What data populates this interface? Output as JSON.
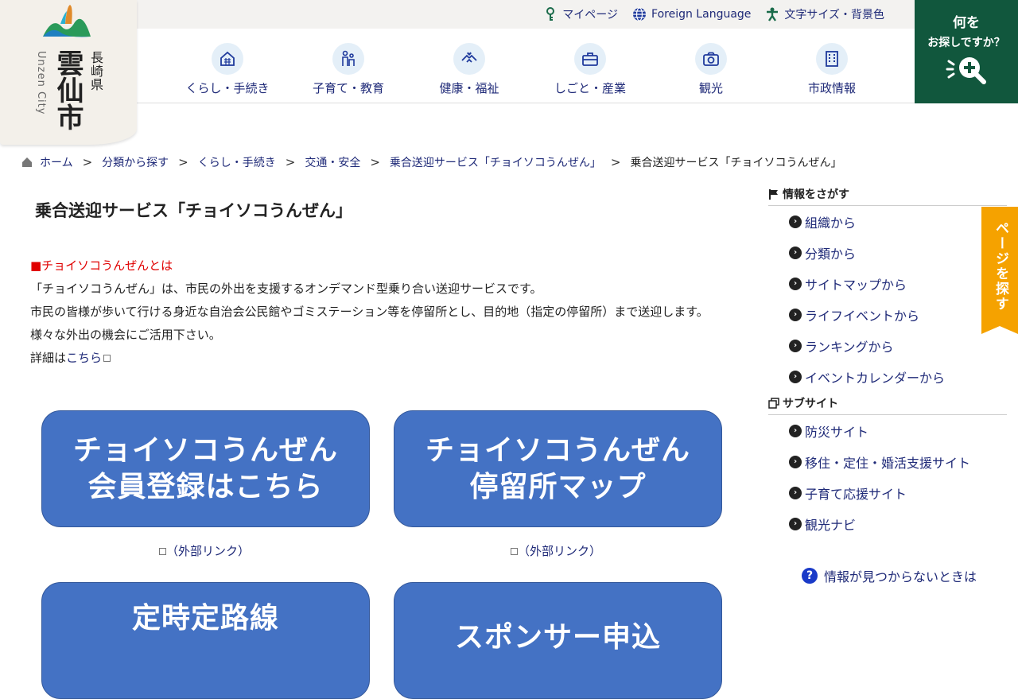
{
  "logo": {
    "city": "雲仙市",
    "prefecture": "長崎県",
    "english": "Unzen City"
  },
  "util": {
    "mypage": "マイページ",
    "foreign": "Foreign Language",
    "fontsize": "文字サイズ・背景色"
  },
  "nav": [
    {
      "label": "くらし・手続き",
      "icon": "house-icon"
    },
    {
      "label": "子育て・教育",
      "icon": "family-icon"
    },
    {
      "label": "健康・福祉",
      "icon": "hands-icon"
    },
    {
      "label": "しごと・産業",
      "icon": "briefcase-icon"
    },
    {
      "label": "観光",
      "icon": "camera-icon"
    },
    {
      "label": "市政情報",
      "icon": "building-icon"
    }
  ],
  "search": {
    "line1": "何を",
    "line2": "お探しですか？"
  },
  "breadcrumb": [
    "ホーム",
    "分類から探す",
    "くらし・手続き",
    "交通・安全",
    "乗合送迎サービス「チョイソコうんぜん」",
    "乗合送迎サービス「チョイソコうんぜん」"
  ],
  "page": {
    "title": "乗合送迎サービス「チョイソコうんぜん」",
    "heading": "■チョイソコうんぜんとは",
    "p1": "「チョイソコうんぜん」は、市民の外出を支援するオンデマンド型乗り合い送迎サービスです。",
    "p2": "市民の皆様が歩いて行ける身近な自治会公民館やゴミステーション等を停留所とし、目的地（指定の停留所）まで送迎します。",
    "p3": "様々な外出の機会にご活用下さい。",
    "detail_prefix": "詳細は",
    "detail_link": "こちら"
  },
  "banners": [
    {
      "line1": "チョイソコうんぜん",
      "line2": "会員登録はこちら"
    },
    {
      "line1": "チョイソコうんぜん",
      "line2": "停留所マップ"
    },
    {
      "line1": "定時定路線",
      "line2": ""
    },
    {
      "line1": "スポンサー申込",
      "line2": ""
    }
  ],
  "external_link": "（外部リンク）",
  "sidebar": {
    "find_head": "情報をさがす",
    "find": [
      "組織から",
      "分類から",
      "サイトマップから",
      "ライフイベントから",
      "ランキングから",
      "イベントカレンダーから"
    ],
    "sub_head": "サブサイト",
    "sub": [
      "防災サイト",
      "移住・定住・婚活支援サイト",
      "子育て応援サイト",
      "観光ナビ"
    ],
    "notfound": "情報が見つからないときは"
  },
  "page_tab": "ページを探す",
  "colors": {
    "nav_text": "#1f2a78",
    "search_bg": "#11573d",
    "banner": "#4472c4",
    "tab": "#f5a200",
    "heading_red": "#e00000"
  }
}
